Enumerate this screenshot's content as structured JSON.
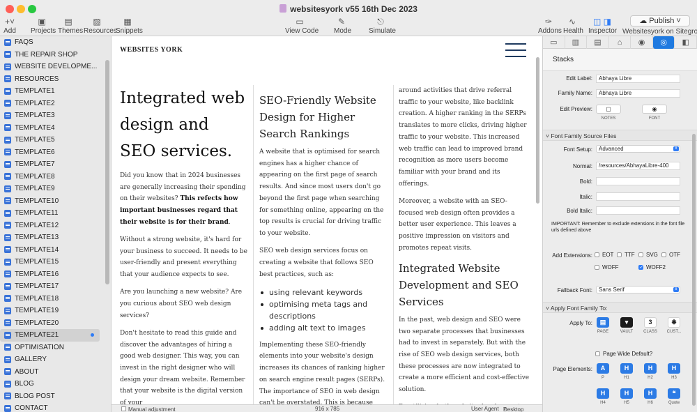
{
  "window": {
    "title": "websitesyork v55 16th Dec 2023"
  },
  "toolbar": {
    "add": "Add",
    "projects": "Projects",
    "themes": "Themes",
    "resources": "Resources",
    "snippets": "Snippets",
    "view_code": "View Code",
    "mode": "Mode",
    "simulate": "Simulate",
    "addons": "Addons",
    "health": "Health",
    "inspector": "Inspector",
    "publish": "Publish",
    "publish_target": "Websitesyork on Siteground"
  },
  "sidebar": {
    "pages": [
      "FAQS",
      "THE REPAIR SHOP",
      "WEBSITE  DEVELOPME...",
      "RESOURCES",
      "TEMPLATE1",
      "TEMPLATE2",
      "TEMPLATE3",
      "TEMPLATE4",
      "TEMPLATE5",
      "TEMPLATE6",
      "TEMPLATE7",
      "TEMPLATE8",
      "TEMPLATE9",
      "TEMPLATE10",
      "TEMPLATE11",
      "TEMPLATE12",
      "TEMPLATE13",
      "TEMPLATE14",
      "TEMPLATE15",
      "TEMPLATE16",
      "TEMPLATE17",
      "TEMPLATE18",
      "TEMPLATE19",
      "TEMPLATE20",
      "TEMPLATE21",
      "OPTIMISATION",
      "GALLERY",
      "ABOUT",
      "BLOG",
      "BLOG POST",
      "CONTACT"
    ],
    "selected_page": "TEMPLATE21"
  },
  "canvas": {
    "logo": "WEBSITES YORK",
    "col1": {
      "heading": "Integrated web design and SEO services.",
      "p1_a": "Did you know that in 2024 businesses are generally increasing their spending on their websites? ",
      "p1_b": "This refects how important businesses regard that their website is for their brand",
      "p1_c": ".",
      "p2": "Without a strong website, it's hard for your business to succeed. It needs to be user-friendly and present everything that your audience expects to see.",
      "p3": "Are you launching a new website? Are you curious about SEO web design services?",
      "p4": "Don't hesitate to read this guide and discover the advantages of hiring a good web designer. This way, you can invest in the right designer who will design your dream website. Remember that your website is the digital version of your"
    },
    "col2": {
      "heading": "SEO-Friendly Website Design for Higher Search Rankings",
      "p1": "A website that is optimised for search engines has a higher chance of appearing on the first page of search results. And since most users don't go beyond the first page when searching for something online, appearing on the top results is crucial for driving traffic to your website.",
      "p2": "SEO web design services focus on creating a website that follows SEO best practices, such as:",
      "bullets": [
        "using relevant keywords",
        "optimising meta tags and descriptions",
        "adding alt text to images"
      ],
      "p3": "Implementing these SEO-friendly elements into your website's design increases its chances of ranking higher on search engine result pages (SERPs). The importance of SEO in web design can't be overstated. This is because search engine"
    },
    "col3": {
      "p1": "around activities that drive referral traffic to your website, like backlink creation. A higher ranking in the SERPs translates to more clicks, driving higher traffic to your website. This increased web traffic can lead to improved brand recognition as more users become familiar with your brand and its offerings.",
      "p2": "Moreover, a website with an SEO-focused web design often provides a better user experience. This leaves a positive impression on visitors and promotes repeat visits.",
      "heading": "Integrated Website Development and SEO Services",
      "p3": "In the past, web design and SEO were two separate processes that businesses had to invest in separately. But with the rise of SEO web design services, both these processes are now integrated to create a more efficient and cost-effective solution.",
      "p4": "By utilising both website development and SEO services, businesses can save"
    }
  },
  "statusbar": {
    "manual": "Manual adjustment",
    "size": "916 x 785",
    "user_agent_label": "User Agent",
    "user_agent": "Desktop"
  },
  "inspector": {
    "title": "Stacks",
    "edit_label_label": "Edit Label:",
    "edit_label": "Abhaya Libre",
    "family_name_label": "Family Name:",
    "family_name": "Abhaya Libre",
    "edit_preview_label": "Edit Preview:",
    "notes": "NOTES",
    "font": "FONT",
    "source_files_section": "Font Family Source Files",
    "font_setup_label": "Font Setup:",
    "font_setup": "Advanced",
    "normal_label": "Normal:",
    "normal": "/resources/AbhayaLibre-400",
    "bold_label": "Bold:",
    "italic_label": "Italic:",
    "bold_italic_label": "Bold Italic:",
    "important": "IMPORTANT: Remember to exclude extensions in the font file urls defined above",
    "add_extensions_label": "Add Extensions:",
    "ext_eot": "EOT",
    "ext_ttf": "TTF",
    "ext_svg": "SVG",
    "ext_otf": "OTF",
    "ext_woff": "WOFF",
    "ext_woff2": "WOFF2",
    "fallback_label": "Fallback Font:",
    "fallback": "Sans Serif",
    "apply_section": "Apply Font Family To:",
    "apply_to_label": "Apply To:",
    "apply_page": "PAGE",
    "apply_vault": "VAULT",
    "apply_class": "CLASS",
    "apply_custom": "CUST...",
    "page_wide": "Page Wide Default?",
    "page_elements_label": "Page Elements:",
    "el_p": "P",
    "el_h1": "H1",
    "el_h2": "H2",
    "el_h3": "H3",
    "el_h4": "H4",
    "el_h5": "H5",
    "el_h6": "H6",
    "el_quote": "Quote"
  }
}
